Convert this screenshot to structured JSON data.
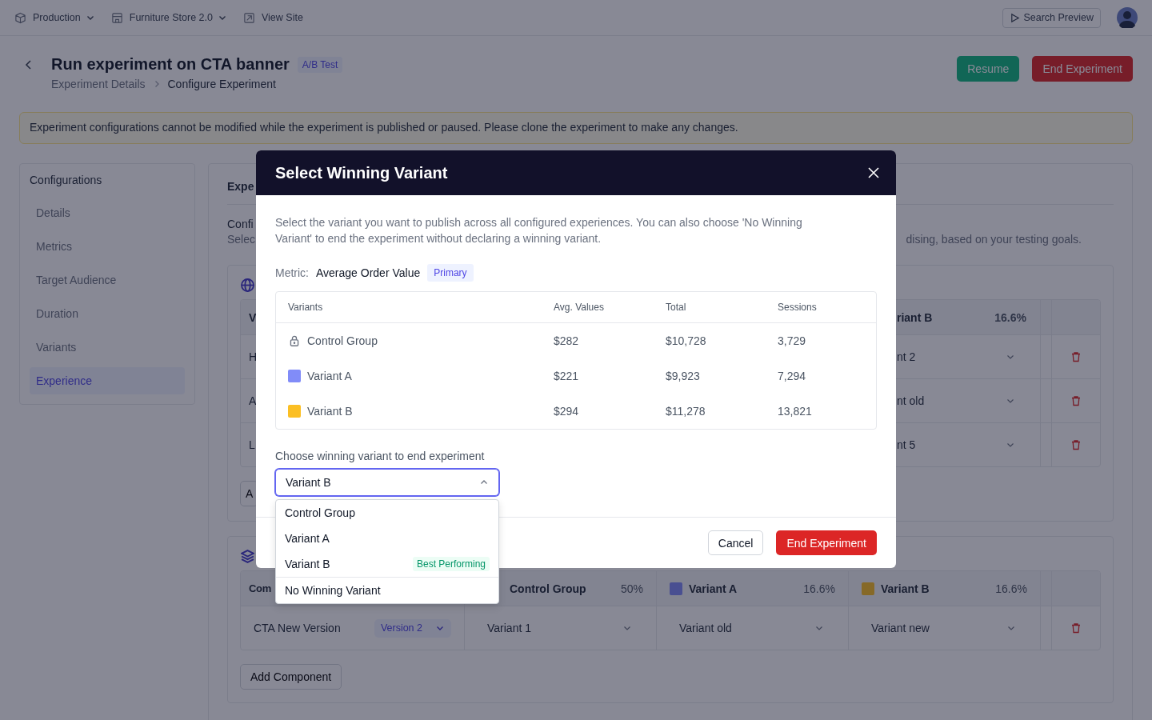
{
  "top_bar": {
    "environment": "Production",
    "site": "Furniture Store 2.0",
    "view_site": "View Site",
    "search_preview": "Search Preview"
  },
  "header": {
    "title": "Run experiment on CTA banner",
    "tag": "A/B Test",
    "breadcrumbs": [
      "Experiment Details",
      "Configure Experiment"
    ],
    "buttons": [
      {
        "label": "Resume",
        "kind": "primary"
      },
      {
        "label": "End Experiment",
        "kind": "danger"
      }
    ]
  },
  "notice": "Experiment configurations cannot be modified while the experiment is published or paused. Please clone the experiment to make any changes.",
  "sidebar": {
    "title": "Configurations",
    "items": [
      {
        "label": "Details",
        "selected": false
      },
      {
        "label": "Metrics",
        "selected": false
      },
      {
        "label": "Target Audience",
        "selected": false
      },
      {
        "label": "Duration",
        "selected": false
      },
      {
        "label": "Variants",
        "selected": false
      },
      {
        "label": "Experience",
        "selected": true
      }
    ]
  },
  "panel": {
    "title": "Expe",
    "subtitle": "Confi",
    "description_start": "Selec",
    "description_end": "dising, based on your testing goals.",
    "pages_table": {
      "header_first": "V",
      "header_last": "riant B",
      "header_share": "16.6%",
      "rows": [
        {
          "first": "H",
          "last": "nt 2"
        },
        {
          "first": "A",
          "last": "nt old"
        },
        {
          "first": "L",
          "last": "nt 5"
        }
      ]
    },
    "pages_add_button": "A",
    "components_table": {
      "header_first": "Com",
      "columns": [
        {
          "name": "Control Group",
          "share": "50%"
        },
        {
          "name": "Variant A",
          "share": "16.6%",
          "color": "#494f91"
        },
        {
          "name": "Variant B",
          "share": "16.6%",
          "color": "#866927"
        }
      ],
      "rows": [
        {
          "component": "CTA New Version",
          "version": "Version 2",
          "cells": [
            "Variant 1",
            "Variant old",
            "Variant new"
          ]
        }
      ]
    },
    "components_add_button": "Add Component"
  },
  "modal": {
    "title": "Select Winning Variant",
    "description": "Select the variant you want to publish across all configured experiences. You can also choose 'No Winning Variant' to end the experiment without declaring a winning variant.",
    "metric_label": "Metric:",
    "metric": "Average Order Value",
    "metric_tag": "Primary",
    "table": {
      "columns": [
        "Variants",
        "Avg. Values",
        "Total",
        "Sessions"
      ],
      "rows": [
        {
          "name": "Control Group",
          "kind": "locked",
          "avg": "$282",
          "total": "$10,728",
          "sessions": "3,729"
        },
        {
          "name": "Variant A",
          "kind": "variant",
          "color": "#818cf8",
          "avg": "$221",
          "total": "$9,923",
          "sessions": "7,294"
        },
        {
          "name": "Variant B",
          "kind": "variant",
          "color": "#fbbf24",
          "avg": "$294",
          "total": "$11,278",
          "sessions": "13,821"
        }
      ]
    },
    "choose_label": "Choose winning variant to end experiment",
    "select": {
      "value": "Variant B",
      "expanded": true
    },
    "options": [
      {
        "label": "Control Group",
        "kind": "variant"
      },
      {
        "label": "Variant A",
        "kind": "variant"
      },
      {
        "label": "Variant B",
        "kind": "variant",
        "badge": "Best Performing"
      },
      {
        "label": "No Winning Variant",
        "kind": "none"
      }
    ],
    "buttons": [
      {
        "label": "Cancel",
        "kind": "secondary"
      },
      {
        "label": "End Experiment",
        "kind": "danger"
      }
    ]
  }
}
